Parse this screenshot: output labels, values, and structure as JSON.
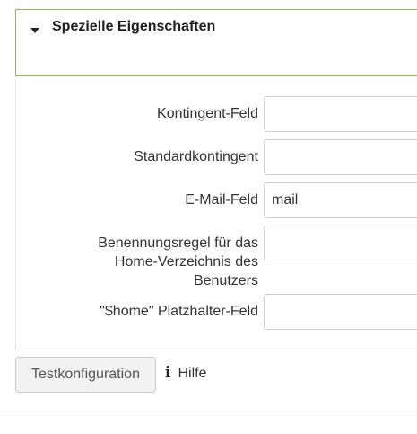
{
  "section": {
    "title": "Spezielle Eigenschaften",
    "expanded": true
  },
  "fields": [
    {
      "label_lines": [
        "Kontingent-Feld"
      ],
      "value": ""
    },
    {
      "label_lines": [
        "Standardkontingent"
      ],
      "value": ""
    },
    {
      "label_lines": [
        "E-Mail-Feld"
      ],
      "value": "mail"
    },
    {
      "label_lines": [
        "Benennungsregel für das",
        "Home-Verzeichnis des",
        "Benutzers"
      ],
      "value": ""
    },
    {
      "label_lines": [
        "\"$home\" Platzhalter-Feld"
      ],
      "value": ""
    }
  ],
  "actions": {
    "test_button": "Testkonfiguration",
    "help_icon": "info-icon",
    "help_link": "Hilfe"
  },
  "colors": {
    "section_border": "#8dbb63",
    "button_bg": "#f2f2f2"
  }
}
